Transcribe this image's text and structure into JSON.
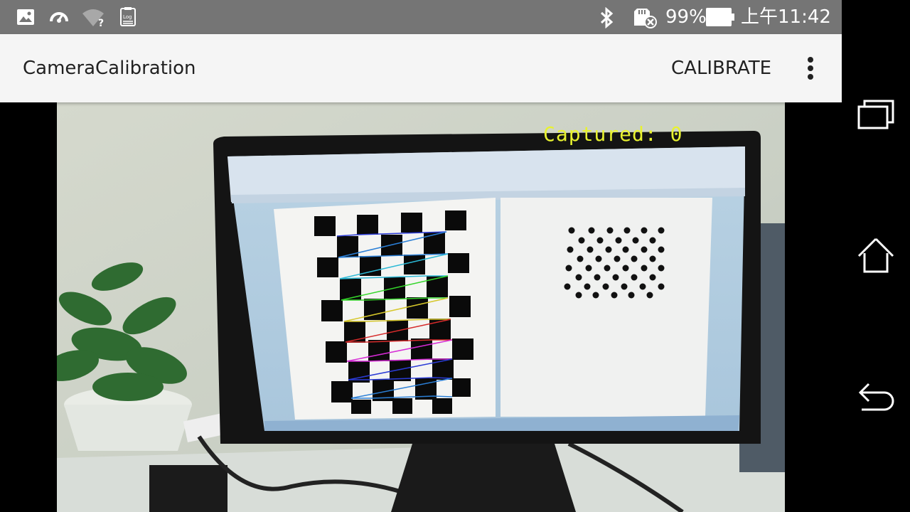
{
  "status_bar": {
    "icons": [
      "image-icon",
      "speed-gauge-icon",
      "wifi-unknown-icon",
      "log-file-icon",
      "bluetooth-icon",
      "sd-card-error-icon",
      "battery-icon"
    ],
    "battery_percent": "99%",
    "time": "上午11:42"
  },
  "action_bar": {
    "title": "CameraCalibration",
    "calibrate_label": "CALIBRATE",
    "overflow_icon": "more-vert-icon"
  },
  "camera": {
    "captured_text": "Captured: 0"
  },
  "nav_bar": {
    "icons": [
      "recents-icon",
      "home-icon",
      "back-icon"
    ]
  },
  "colors": {
    "status_bar_bg": "#757575",
    "action_bar_bg": "#f5f5f5",
    "overlay_text": "#e8f230"
  }
}
